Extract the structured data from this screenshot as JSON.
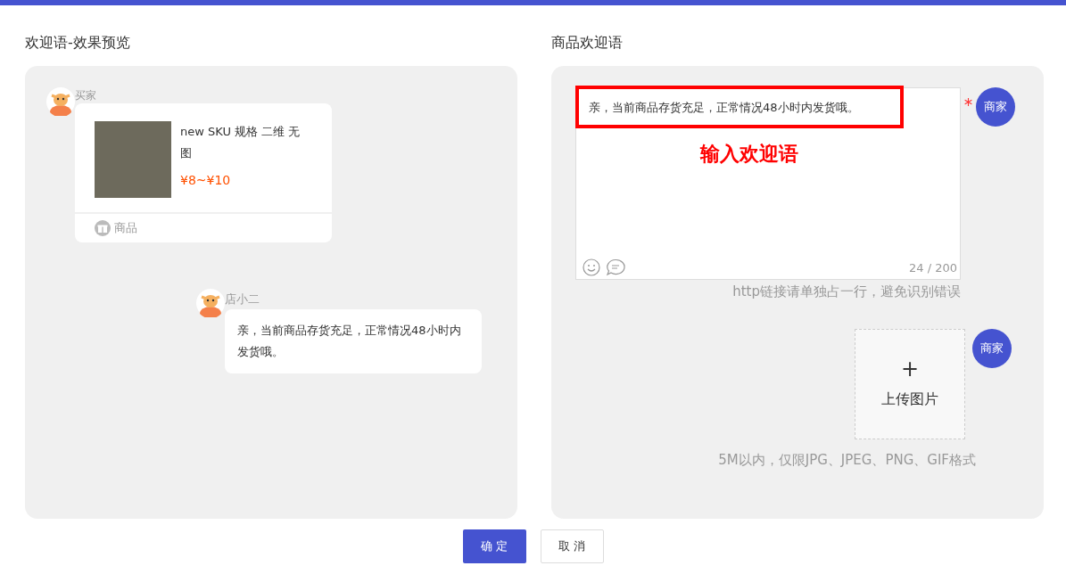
{
  "preview": {
    "title": "欢迎语-效果预览",
    "messages": [
      {
        "kind": "product",
        "sender": "买家",
        "product_name": "new SKU 规格 二维 无图",
        "price": "¥8~¥10",
        "footer_label": "商品"
      },
      {
        "kind": "text",
        "sender": "店小二",
        "text": "亲，当前商品存货充足，正常情况48小时内发货哦。"
      }
    ]
  },
  "editor": {
    "title": "商品欢迎语",
    "text_field": {
      "value": "亲，当前商品存货充足，正常情况48小时内发货哦。",
      "counter": "24 / 200",
      "required": true,
      "role_badge": "商家",
      "hint": "http链接请单独占一行，避免识别错误"
    },
    "annotation": "输入欢迎语",
    "upload": {
      "plus": "+",
      "label": "上传图片",
      "role_badge": "商家",
      "hint": "5M以内，仅限JPG、JPEG、PNG、GIF格式"
    }
  },
  "buttons": [
    {
      "label": "确 定",
      "kind": "primary"
    },
    {
      "label": "取 消",
      "kind": "secondary"
    }
  ]
}
